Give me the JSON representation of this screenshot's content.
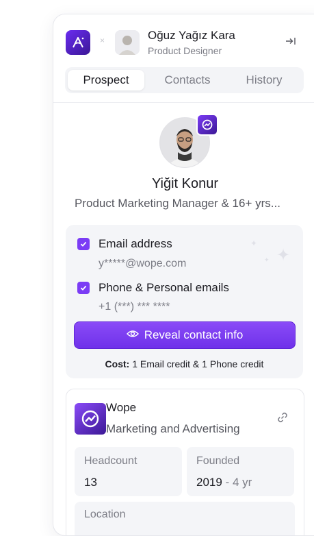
{
  "header": {
    "separator": "×",
    "user_name": "Oğuz Yağız Kara",
    "user_role": "Product Designer",
    "collapse_icon": "collapse-right-icon"
  },
  "tabs": [
    {
      "label": "Prospect",
      "active": true
    },
    {
      "label": "Contacts",
      "active": false
    },
    {
      "label": "History",
      "active": false
    }
  ],
  "prospect": {
    "name": "Yiğit Konur",
    "title": "Product Marketing Manager & 16+ yrs..."
  },
  "reveal": {
    "options": [
      {
        "label": "Email address",
        "value": "y*****@wope.com",
        "checked": true
      },
      {
        "label": "Phone & Personal emails",
        "value": "+1 (***) *** ****",
        "checked": true
      }
    ],
    "button_label": "Reveal contact info",
    "cost_label": "Cost:",
    "cost_text": "1 Email credit & 1 Phone credit"
  },
  "company": {
    "name": "Wope",
    "industry": "Marketing and Advertising",
    "headcount_label": "Headcount",
    "headcount_value": "13",
    "founded_label": "Founded",
    "founded_year": "2019",
    "founded_sep": " - ",
    "founded_age": "4 yr",
    "location_label": "Location"
  },
  "colors": {
    "accent": "#7b3cf5",
    "surface": "#f4f5f8",
    "border": "#e6e7ec"
  }
}
